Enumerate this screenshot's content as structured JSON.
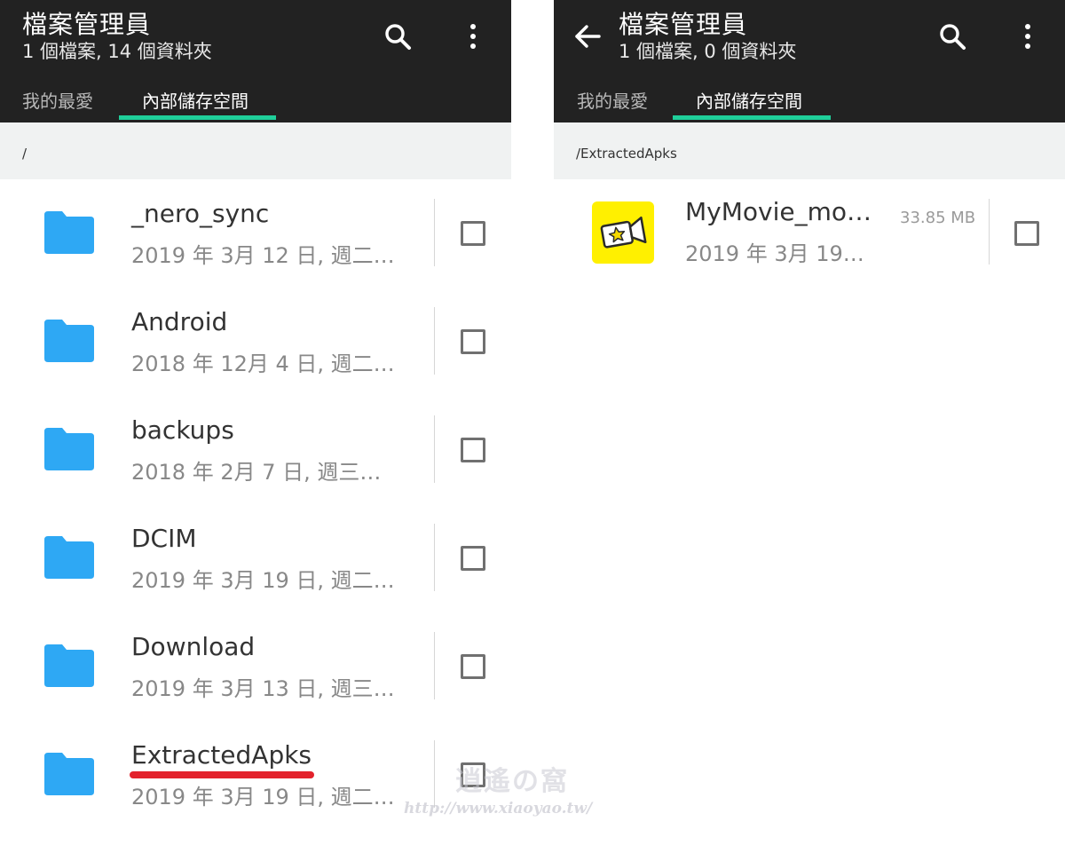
{
  "left": {
    "title": "檔案管理員",
    "subtitle": "1 個檔案, 14 個資料夾",
    "tabs": [
      {
        "label": "我的最愛"
      },
      {
        "label": "內部儲存空間"
      }
    ],
    "path": "/",
    "items": [
      {
        "name": "_nero_sync",
        "date": "2019 年 3月 12 日, 週二…"
      },
      {
        "name": "Android",
        "date": "2018 年 12月 4 日, 週二…"
      },
      {
        "name": "backups",
        "date": "2018 年 2月 7 日, 週三…"
      },
      {
        "name": "DCIM",
        "date": "2019 年 3月 19 日, 週二…"
      },
      {
        "name": "Download",
        "date": "2019 年 3月 13 日, 週三…"
      },
      {
        "name": "ExtractedApks",
        "date": "2019 年 3月 19 日, 週二…"
      }
    ]
  },
  "right": {
    "title": "檔案管理員",
    "subtitle": "1 個檔案, 0 個資料夾",
    "tabs": [
      {
        "label": "我的最愛"
      },
      {
        "label": "內部儲存空間"
      }
    ],
    "path": "/ExtractedApks",
    "items": [
      {
        "name": "MyMovie_mo…",
        "date": "2019 年 3月 19…",
        "size": "33.85 MB"
      }
    ]
  },
  "watermark": {
    "logo": "逍遙の窩",
    "url": "http://www.xiaoyao.tw/"
  },
  "icons": {
    "search": "search-icon",
    "more": "more-vert-icon",
    "back": "arrow-back-icon",
    "folder": "folder-icon",
    "app": "video-star-app-icon"
  },
  "colors": {
    "appbar": "#222222",
    "tab_indicator": "#1fcf9a",
    "folder": "#2ea8f4",
    "app_icon_bg": "#fff000",
    "highlight_underline": "#e3222c"
  }
}
